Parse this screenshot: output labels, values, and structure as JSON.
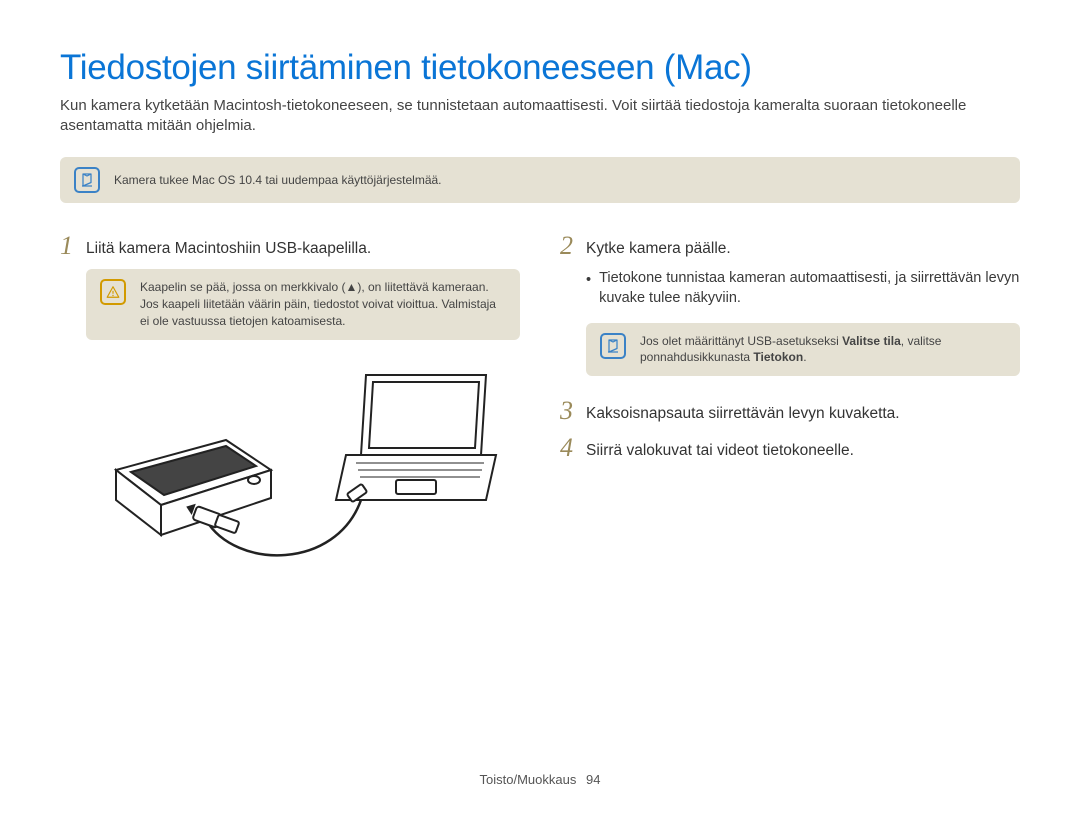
{
  "title": "Tiedostojen siirtäminen tietokoneeseen (Mac)",
  "intro": "Kun kamera kytketään Macintosh-tietokoneeseen, se tunnistetaan automaattisesti. Voit siirtää tiedostoja kameralta suoraan tietokoneelle asentamatta mitään ohjelmia.",
  "topnote": "Kamera tukee Mac OS 10.4 tai uudempaa käyttöjärjestelmää.",
  "left": {
    "step1_num": "1",
    "step1_text": "Liitä kamera Macintoshiin USB-kaapelilla.",
    "warn_text": "Kaapelin se pää, jossa on merkkivalo (▲), on liitettävä kameraan. Jos kaapeli liitetään väärin päin, tiedostot voivat vioittua. Valmistaja ei ole vastuussa tietojen katoamisesta."
  },
  "right": {
    "step2_num": "2",
    "step2_text": "Kytke kamera päälle.",
    "step2_sub": "Tietokone tunnistaa kameran automaattisesti, ja siirrettävän levyn kuvake tulee näkyviin.",
    "note2_pre": "Jos olet määrittänyt USB-asetukseksi ",
    "note2_bold1": "Valitse tila",
    "note2_mid": ", valitse ponnahdusikkunasta ",
    "note2_bold2": "Tietokon",
    "note2_post": ".",
    "step3_num": "3",
    "step3_text": "Kaksoisnapsauta siirrettävän levyn kuvaketta.",
    "step4_num": "4",
    "step4_text": "Siirrä valokuvat tai videot tietokoneelle."
  },
  "footer": {
    "section": "Toisto/Muokkaus",
    "page": "94"
  }
}
